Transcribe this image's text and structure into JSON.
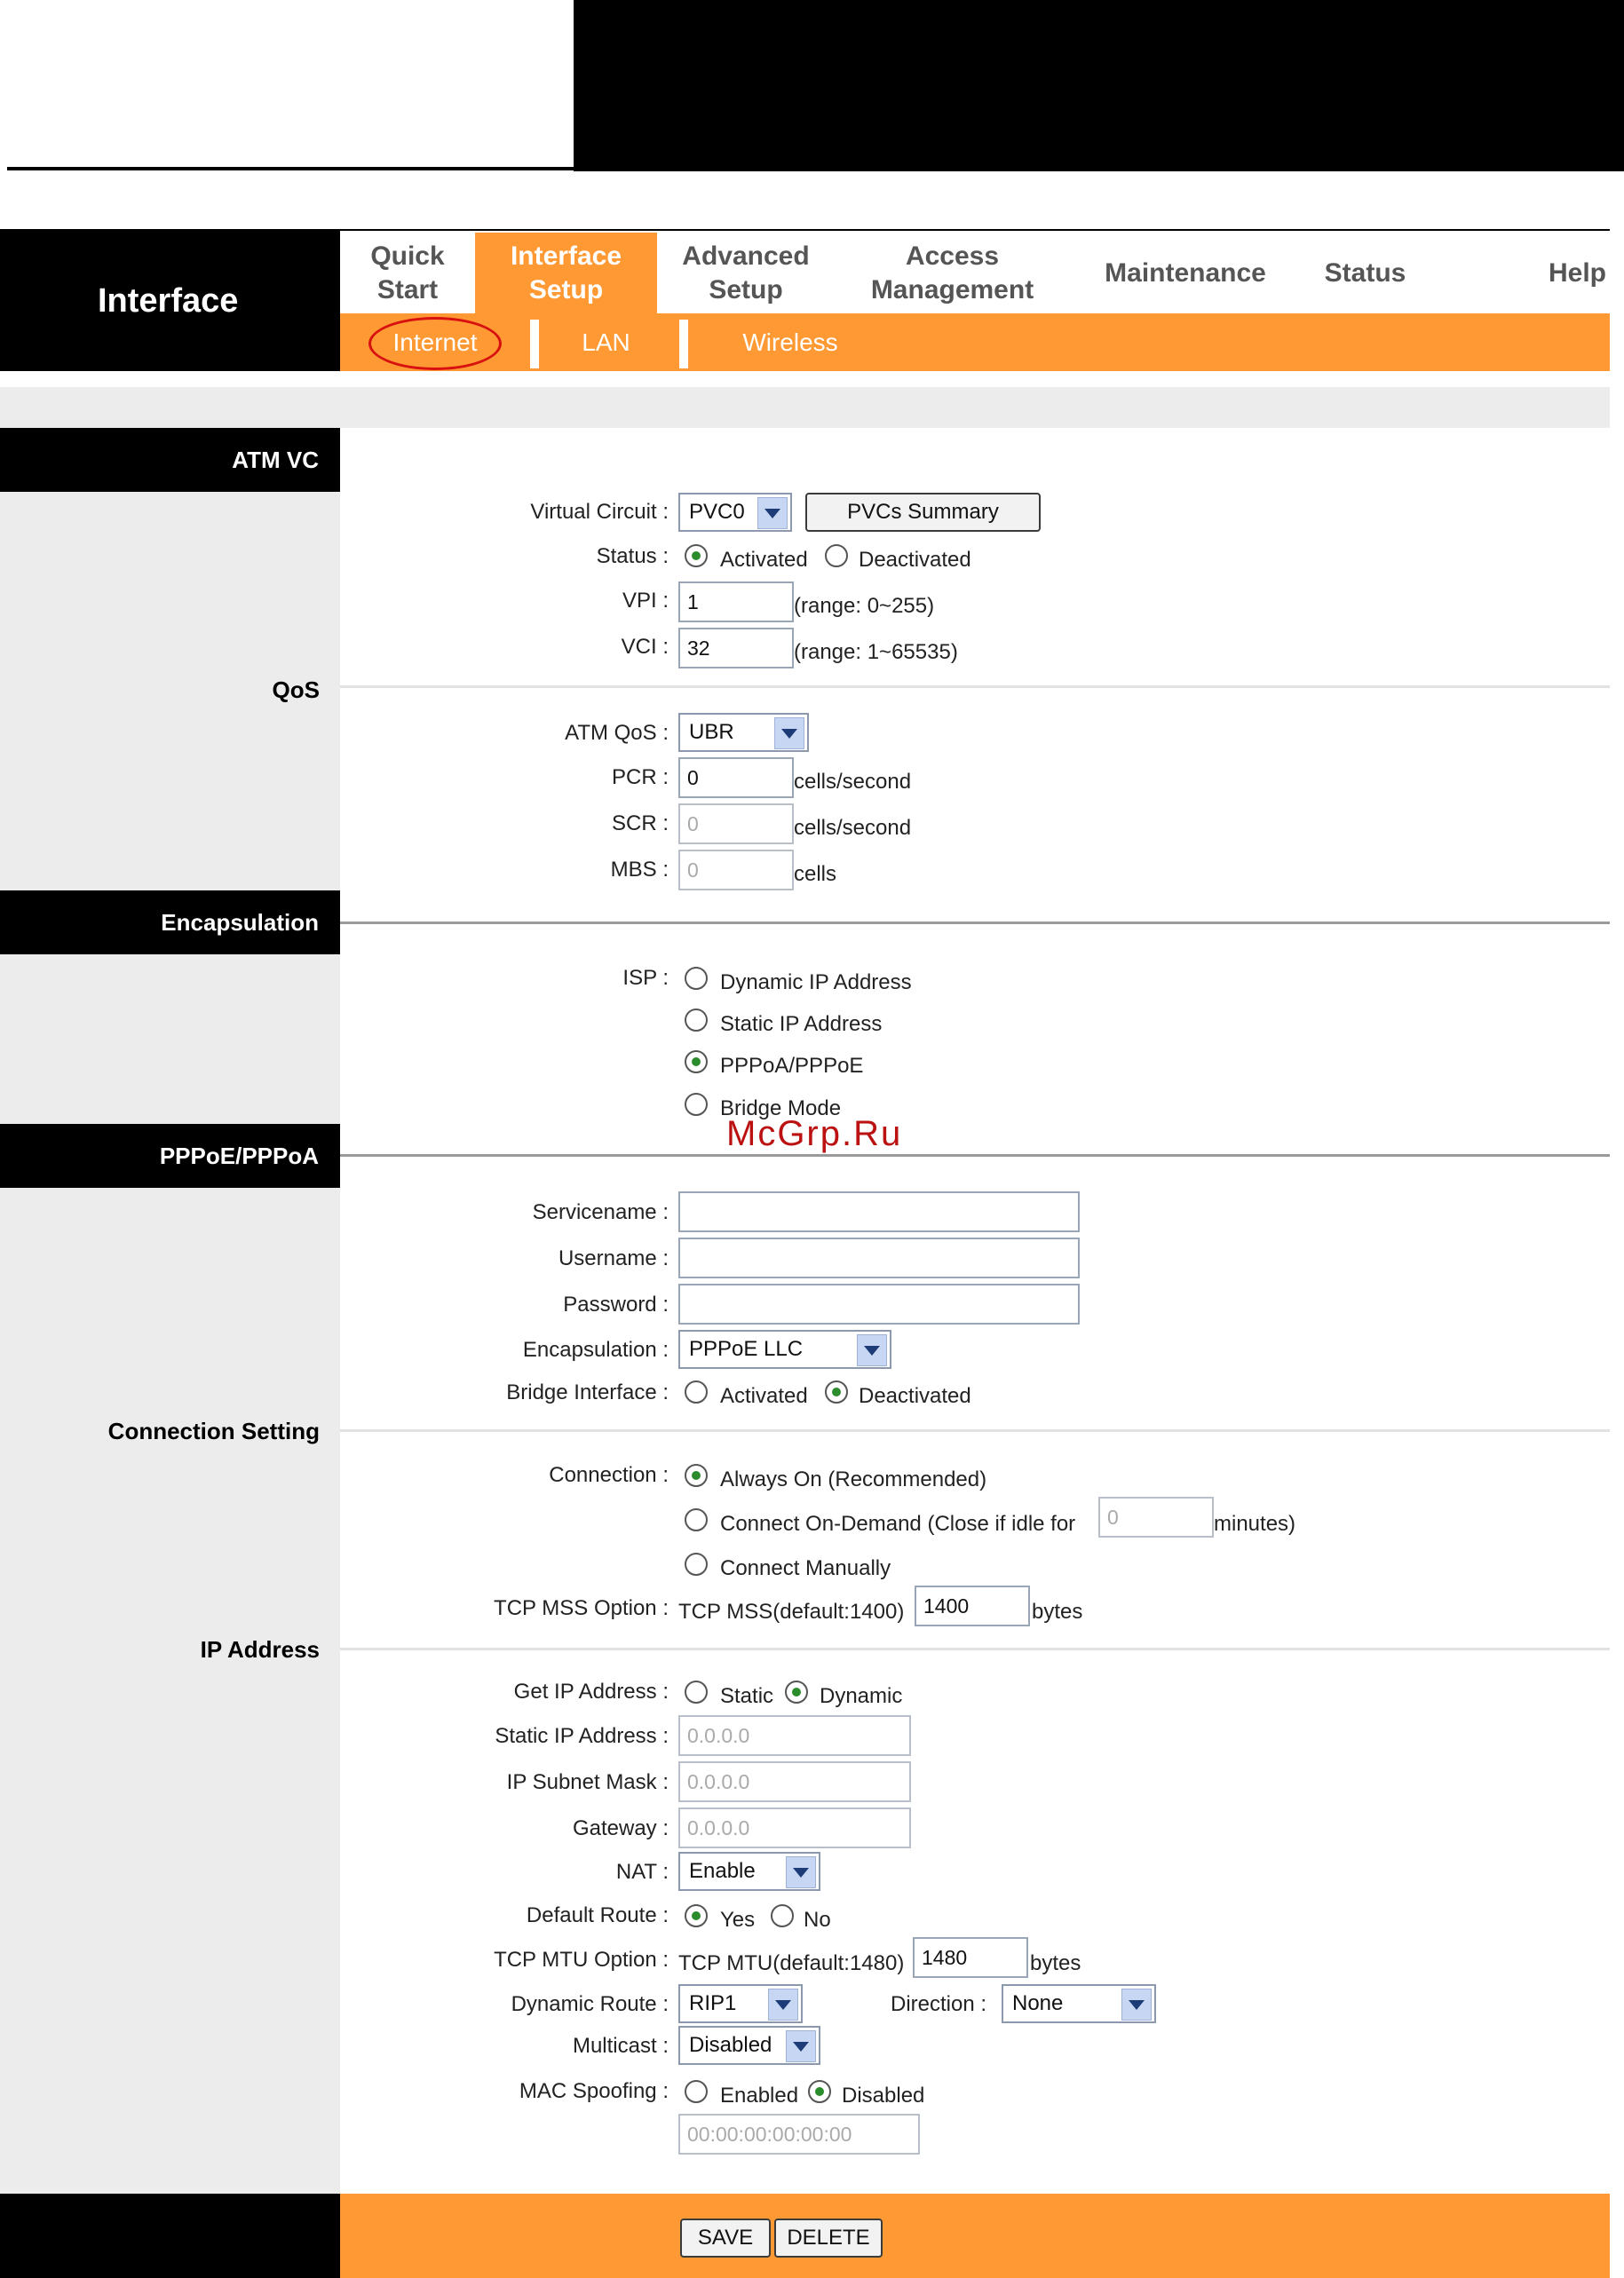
{
  "nav": {
    "section_title": "Interface",
    "menu": [
      {
        "line1": "Quick",
        "line2": "Start"
      },
      {
        "line1": "Interface",
        "line2": "Setup"
      },
      {
        "line1": "Advanced",
        "line2": "Setup"
      },
      {
        "line1": "Access",
        "line2": "Management"
      },
      {
        "line1": "Maintenance",
        "line2": ""
      },
      {
        "line1": "Status",
        "line2": ""
      },
      {
        "line1": "Help",
        "line2": ""
      }
    ],
    "submenu": [
      "Internet",
      "LAN",
      "Wireless"
    ]
  },
  "sections": {
    "atm_vc": "ATM VC",
    "qos": "QoS",
    "encapsulation": "Encapsulation",
    "pppoe": "PPPoE/PPPoA",
    "connection_setting": "Connection Setting",
    "ip_address": "IP Address"
  },
  "atm": {
    "virtual_circuit_label": "Virtual Circuit :",
    "virtual_circuit_value": "PVC0",
    "pvcs_summary_button": "PVCs Summary",
    "status_label": "Status :",
    "status_activated": "Activated",
    "status_deactivated": "Deactivated",
    "vpi_label": "VPI :",
    "vpi_value": "1",
    "vpi_range": "(range: 0~255)",
    "vci_label": "VCI :",
    "vci_value": "32",
    "vci_range": "(range: 1~65535)"
  },
  "qos": {
    "atm_qos_label": "ATM QoS :",
    "atm_qos_value": "UBR",
    "pcr_label": "PCR :",
    "pcr_value": "0",
    "pcr_unit": "cells/second",
    "scr_label": "SCR :",
    "scr_value": "0",
    "scr_unit": "cells/second",
    "mbs_label": "MBS :",
    "mbs_value": "0",
    "mbs_unit": "cells"
  },
  "encap": {
    "isp_label": "ISP :",
    "options": [
      "Dynamic IP Address",
      "Static IP Address",
      "PPPoA/PPPoE",
      "Bridge Mode"
    ],
    "selected": "PPPoA/PPPoE"
  },
  "pppoe": {
    "servicename_label": "Servicename :",
    "servicename_value": "",
    "username_label": "Username :",
    "username_value": "",
    "password_label": "Password :",
    "password_value": "",
    "encapsulation_label": "Encapsulation :",
    "encapsulation_value": "PPPoE LLC",
    "bridge_label": "Bridge Interface :",
    "bridge_activated": "Activated",
    "bridge_deactivated": "Deactivated"
  },
  "connection": {
    "connection_label": "Connection :",
    "always_on": "Always On (Recommended)",
    "on_demand": "Connect On-Demand (Close if idle for",
    "idle_value": "0",
    "idle_unit": "minutes)",
    "manual": "Connect Manually",
    "tcp_mss_label": "TCP MSS Option :",
    "tcp_mss_text": "TCP MSS(default:1400)",
    "tcp_mss_value": "1400",
    "tcp_mss_unit": "bytes"
  },
  "ip": {
    "get_ip_label": "Get IP Address :",
    "static": "Static",
    "dynamic": "Dynamic",
    "static_ip_label": "Static IP Address :",
    "static_ip_value": "0.0.0.0",
    "subnet_label": "IP Subnet Mask :",
    "subnet_value": "0.0.0.0",
    "gateway_label": "Gateway :",
    "gateway_value": "0.0.0.0",
    "nat_label": "NAT :",
    "nat_value": "Enable",
    "default_route_label": "Default Route :",
    "yes": "Yes",
    "no": "No",
    "tcp_mtu_label": "TCP MTU Option :",
    "tcp_mtu_text": "TCP MTU(default:1480)",
    "tcp_mtu_value": "1480",
    "tcp_mtu_unit": "bytes",
    "dynamic_route_label": "Dynamic Route :",
    "dynamic_route_value": "RIP1",
    "direction_label": "Direction :",
    "direction_value": "None",
    "multicast_label": "Multicast :",
    "multicast_value": "Disabled",
    "mac_spoofing_label": "MAC Spoofing :",
    "mac_enabled": "Enabled",
    "mac_disabled": "Disabled",
    "mac_value": "00:00:00:00:00:00"
  },
  "footer": {
    "save": "SAVE",
    "delete": "DELETE"
  },
  "watermark": "McGrp.Ru"
}
